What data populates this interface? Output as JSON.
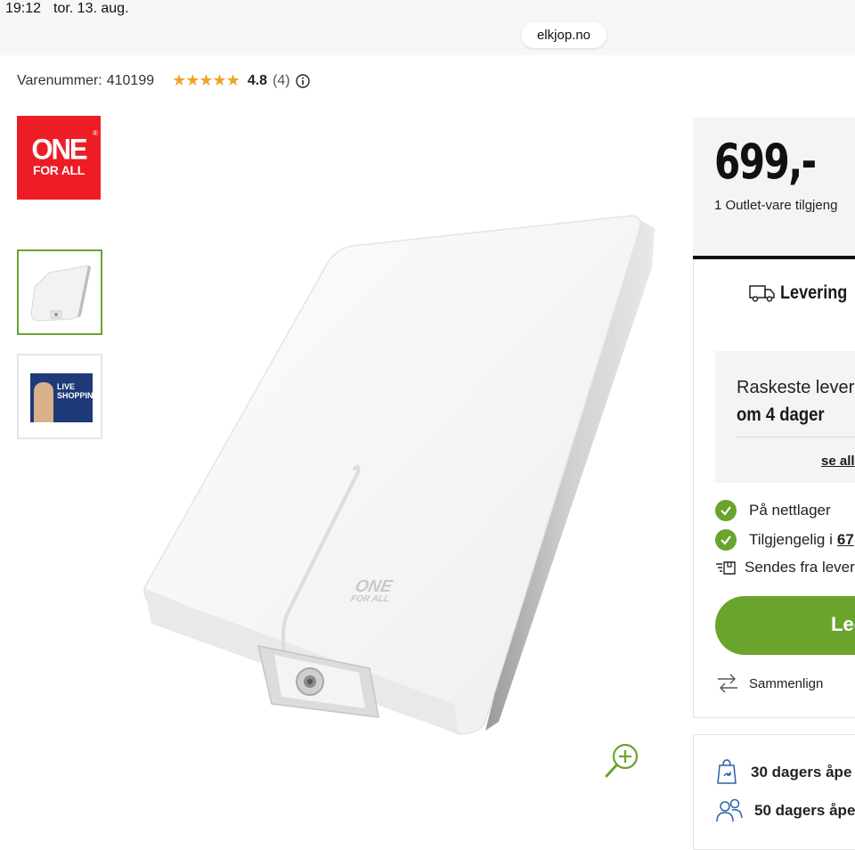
{
  "status_bar": {
    "time": "19:12",
    "date": "tor. 13. aug."
  },
  "browser": {
    "url": "elkjop.no"
  },
  "product": {
    "sku_label": "Varenummer:",
    "sku": "410199",
    "stars": "★★★★★",
    "rating": "4.8",
    "review_count": "(4)"
  },
  "brand_logo": {
    "line1": "ONE",
    "line2": "FOR ALL"
  },
  "thumbnails": [
    {
      "caption": ""
    },
    {
      "caption": "LIVE SHOPPING",
      "line1": "LIVE",
      "line2": "SHOPPING"
    }
  ],
  "price_card": {
    "price": "699,-",
    "outlet": "1 Outlet-vare tilgjeng"
  },
  "delivery": {
    "title": "Levering",
    "fastest_label": "Raskeste leveri",
    "fastest_value": "om 4 dager",
    "see_all": "se alle"
  },
  "stock": {
    "online": "På nettlager",
    "available_prefix": "Tilgjengelig i",
    "available_count": "67",
    "shipped_from": "Sendes fra levera"
  },
  "cta": {
    "label": "Leg"
  },
  "compare": {
    "label": "Sammenlign"
  },
  "returns": {
    "open_purchase": "30 dagers åpe",
    "price_guarantee": "50 dagers åpe"
  },
  "colors": {
    "accent_green": "#6aa42c",
    "brand_red": "#ee1c25",
    "star_gold": "#f0a427"
  }
}
